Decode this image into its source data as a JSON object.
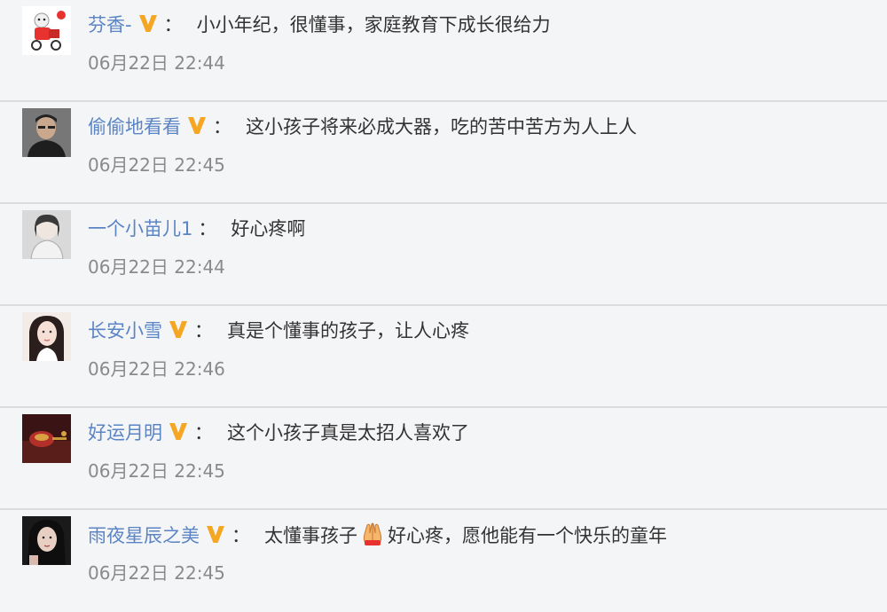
{
  "comments": [
    {
      "username": "芬香-",
      "verified": true,
      "colon": "：",
      "text_before": "小小年纪，很懂事，家庭教育下成长很给力",
      "emoji": null,
      "text_after": "",
      "time": "06月22日 22:44",
      "avatar": "delivery-cartoon-avatar"
    },
    {
      "username": "偷偷地看看",
      "verified": true,
      "colon": "：",
      "text_before": "这小孩子将来必成大器，吃的苦中苦方为人上人",
      "emoji": null,
      "text_after": "",
      "time": "06月22日 22:45",
      "avatar": "man-portrait-avatar"
    },
    {
      "username": "一个小苗儿1",
      "verified": false,
      "colon": "：",
      "text_before": "好心疼啊",
      "emoji": null,
      "text_after": "",
      "time": "06月22日 22:44",
      "avatar": "girl-sketch-avatar"
    },
    {
      "username": "长安小雪",
      "verified": true,
      "colon": "：",
      "text_before": "真是个懂事的孩子，让人心疼",
      "emoji": null,
      "text_after": "",
      "time": "06月22日 22:46",
      "avatar": "woman-portrait-avatar"
    },
    {
      "username": "好运月明",
      "verified": true,
      "colon": "：",
      "text_before": "这个小孩子真是太招人喜欢了",
      "emoji": null,
      "text_after": "",
      "time": "06月22日 22:45",
      "avatar": "red-ornament-avatar"
    },
    {
      "username": "雨夜星辰之美",
      "verified": true,
      "colon": "：",
      "text_before": "太懂事孩子",
      "emoji": "praying-hands-emoji",
      "text_after": "好心疼，愿他能有一个快乐的童年",
      "time": "06月22日 22:45",
      "avatar": "woman-dark-portrait-avatar"
    }
  ],
  "colors": {
    "background": "#f4f5f7",
    "username": "#5b84c4",
    "text": "#333333",
    "time": "#8a8a8a",
    "badge": "#f5a623",
    "divider": "#dcdcdc"
  }
}
